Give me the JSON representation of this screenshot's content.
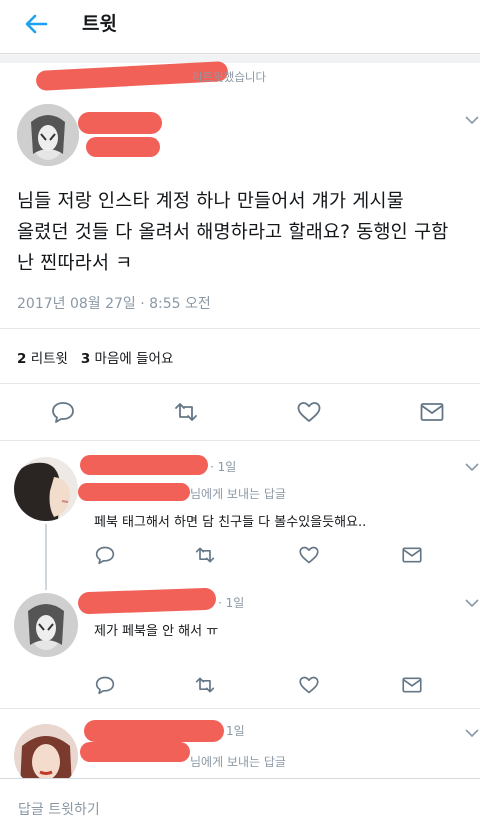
{
  "header": {
    "title": "트윗"
  },
  "retweet_notice": "리트윗했습니다",
  "tweet": {
    "text_lines": [
      "님들 저랑 인스타 계정 하나 만들어서 걔가 게시물",
      "올렸던 것들 다 올려서 해명하라고 할래요? 동행인 구함",
      "난 찐따라서 ㅋ"
    ],
    "date": "2017년 08월 27일 · 8:55 오전",
    "retweet_count": "2",
    "retweet_label": "리트윗",
    "like_count": "3",
    "like_label": "마음에 들어요"
  },
  "replies": [
    {
      "time": "· 1일",
      "reply_to_suffix": "님에게 보내는 답글",
      "text": "페북 태그해서 하면 담 친구들 다 볼수있을듯해요.."
    },
    {
      "time": "· 1일",
      "text": "제가 페북을 안 해서 ㅠ"
    },
    {
      "time": "1일",
      "reply_to_suffix": "님에게 보내는 답글"
    }
  ],
  "compose": {
    "placeholder": "답글 트윗하기"
  },
  "colors": {
    "accent": "#1da1f2",
    "icon_gray": "#657786",
    "redaction": "#f0594e"
  }
}
